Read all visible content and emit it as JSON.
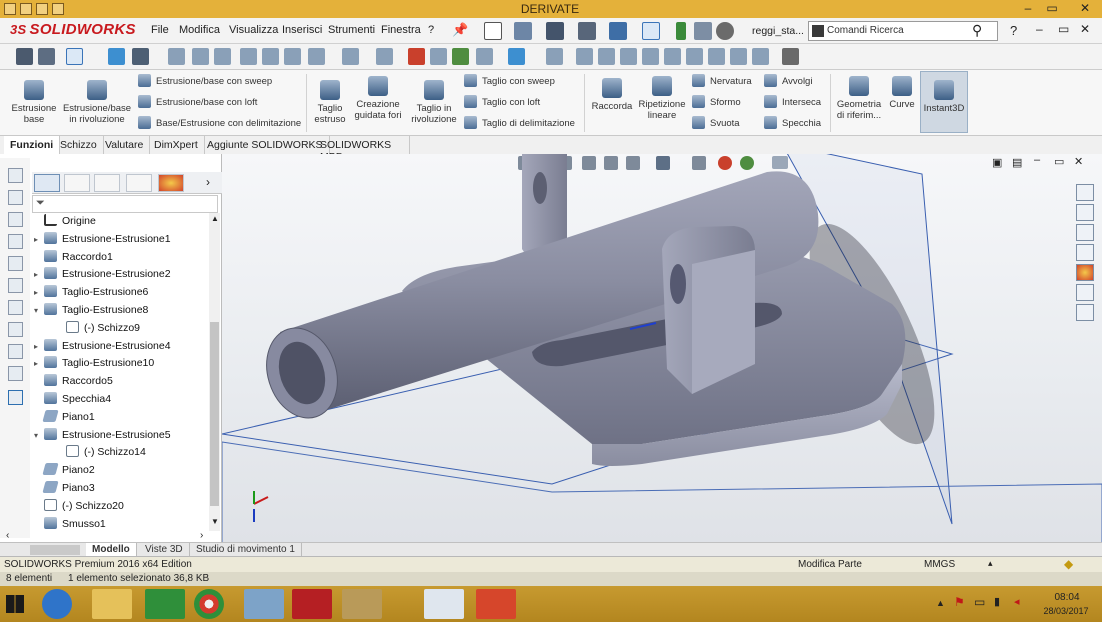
{
  "window": {
    "title": "DERIVATE"
  },
  "app": {
    "logo_text": "SOLIDWORKS",
    "logo_ds": "3S"
  },
  "menu": [
    "File",
    "Modifica",
    "Visualizza",
    "Inserisci",
    "Strumenti",
    "Finestra",
    "?"
  ],
  "doc_name": "reggi_sta...",
  "search": {
    "placeholder": "Comandi Ricerca"
  },
  "ribbon": {
    "big": [
      {
        "label": "Estrusione base"
      },
      {
        "label": "Estrusione/base in rivoluzione"
      },
      {
        "label": "Taglio estruso"
      },
      {
        "label": "Creazione guidata fori"
      },
      {
        "label": "Taglio in rivoluzione"
      },
      {
        "label": "Raccorda"
      },
      {
        "label": "Ripetizione lineare"
      },
      {
        "label": "Geometria di riferim..."
      },
      {
        "label": "Curve"
      },
      {
        "label": "Instant3D"
      }
    ],
    "small": [
      {
        "label": "Estrusione/base con sweep"
      },
      {
        "label": "Estrusione/base con loft"
      },
      {
        "label": "Base/Estrusione con delimitazione"
      },
      {
        "label": "Taglio con sweep"
      },
      {
        "label": "Taglio con loft"
      },
      {
        "label": "Taglio di delimitazione"
      },
      {
        "label": "Nervatura"
      },
      {
        "label": "Sformo"
      },
      {
        "label": "Svuota"
      },
      {
        "label": "Avvolgi"
      },
      {
        "label": "Interseca"
      },
      {
        "label": "Specchia"
      }
    ]
  },
  "tabs": [
    "Funzioni",
    "Schizzo",
    "Valutare",
    "DimXpert",
    "Aggiunte SOLIDWORKS",
    "SOLIDWORKS MBD"
  ],
  "tree": [
    {
      "label": "Origine",
      "exp": "",
      "icon": "origin"
    },
    {
      "label": "Estrusione-Estrusione1",
      "exp": "▸",
      "icon": "feature"
    },
    {
      "label": "Raccordo1",
      "exp": "",
      "icon": "feature"
    },
    {
      "label": "Estrusione-Estrusione2",
      "exp": "▸",
      "icon": "feature"
    },
    {
      "label": "Taglio-Estrusione6",
      "exp": "▸",
      "icon": "feature"
    },
    {
      "label": "Taglio-Estrusione8",
      "exp": "▾",
      "icon": "feature"
    },
    {
      "label": "(-) Schizzo9",
      "exp": "",
      "icon": "sketch",
      "indent": true
    },
    {
      "label": "Estrusione-Estrusione4",
      "exp": "▸",
      "icon": "feature"
    },
    {
      "label": "Taglio-Estrusione10",
      "exp": "▸",
      "icon": "feature"
    },
    {
      "label": "Raccordo5",
      "exp": "",
      "icon": "feature"
    },
    {
      "label": "Specchia4",
      "exp": "",
      "icon": "feature"
    },
    {
      "label": "Piano1",
      "exp": "",
      "icon": "plane"
    },
    {
      "label": "Estrusione-Estrusione5",
      "exp": "▾",
      "icon": "feature"
    },
    {
      "label": "(-) Schizzo14",
      "exp": "",
      "icon": "sketch",
      "indent": true
    },
    {
      "label": "Piano2",
      "exp": "",
      "icon": "plane"
    },
    {
      "label": "Piano3",
      "exp": "",
      "icon": "plane"
    },
    {
      "label": "(-) Schizzo20",
      "exp": "",
      "icon": "sketch"
    },
    {
      "label": "Smusso1",
      "exp": "",
      "icon": "feature"
    }
  ],
  "bottom_tabs": [
    "Modello",
    "Viste 3D",
    "Studio di movimento 1"
  ],
  "status": {
    "left": "SOLIDWORKS Premium 2016 x64 Edition",
    "mode": "Modifica Parte",
    "units": "MMGS"
  },
  "info": {
    "count": "8 elementi",
    "selected": "1 elemento selezionato  36,8 KB"
  },
  "clock": {
    "time": "08:04",
    "date": "28/03/2017"
  },
  "colors": {
    "accent": "#c8191e",
    "titlebar": "#e4b13a",
    "model": "#6e7185"
  }
}
